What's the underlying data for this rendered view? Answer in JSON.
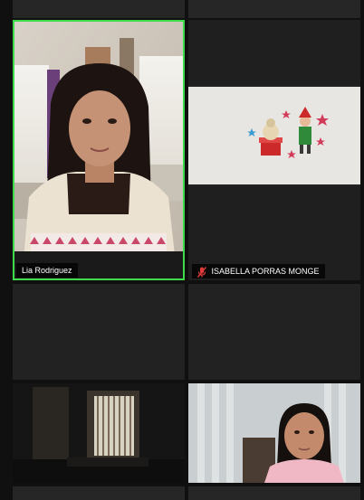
{
  "participants": [
    {
      "name": "Lia Rodriguez",
      "speaking": true,
      "muted": false,
      "video_on": true
    },
    {
      "name": "ISABELLA PORRAS MONGE",
      "speaking": false,
      "muted": true,
      "video_on": true
    },
    {
      "name": "",
      "speaking": false,
      "muted": false,
      "video_on": false
    },
    {
      "name": "",
      "speaking": false,
      "muted": false,
      "video_on": false
    },
    {
      "name": "",
      "speaking": false,
      "muted": false,
      "video_on": true
    },
    {
      "name": "",
      "speaking": false,
      "muted": false,
      "video_on": true
    }
  ],
  "colors": {
    "active_speaker_border": "#3ddc4a",
    "muted_icon": "#e03a3a",
    "tile_background": "#232323"
  },
  "icons": {
    "muted_mic": "mic-off-icon"
  }
}
